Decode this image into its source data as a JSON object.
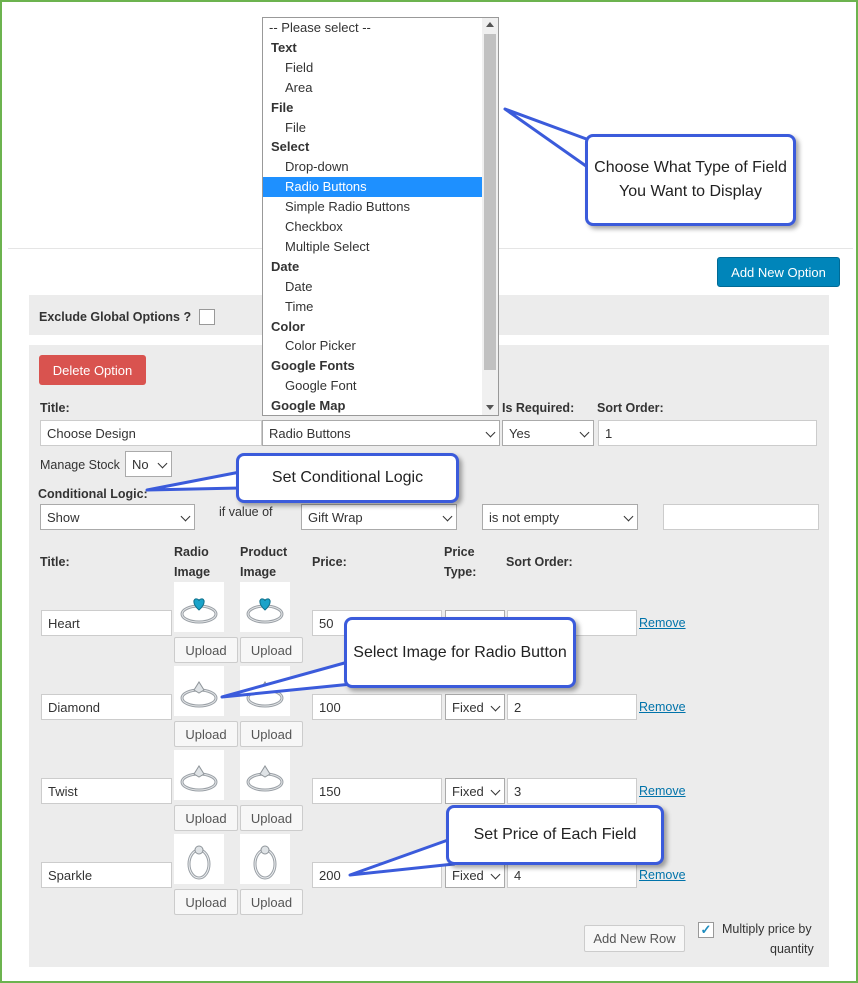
{
  "dropdown_list": {
    "items": [
      {
        "label": "-- Please select --",
        "kind": "placeholder"
      },
      {
        "label": "Text",
        "kind": "group"
      },
      {
        "label": "Field",
        "kind": "option"
      },
      {
        "label": "Area",
        "kind": "option"
      },
      {
        "label": "File",
        "kind": "group"
      },
      {
        "label": "File",
        "kind": "option"
      },
      {
        "label": "Select",
        "kind": "group"
      },
      {
        "label": "Drop-down",
        "kind": "option"
      },
      {
        "label": "Radio Buttons",
        "kind": "option",
        "selected": true
      },
      {
        "label": "Simple Radio Buttons",
        "kind": "option"
      },
      {
        "label": "Checkbox",
        "kind": "option"
      },
      {
        "label": "Multiple Select",
        "kind": "option"
      },
      {
        "label": "Date",
        "kind": "group"
      },
      {
        "label": "Date",
        "kind": "option"
      },
      {
        "label": "Time",
        "kind": "option"
      },
      {
        "label": "Color",
        "kind": "group"
      },
      {
        "label": "Color Picker",
        "kind": "option"
      },
      {
        "label": "Google Fonts",
        "kind": "group"
      },
      {
        "label": "Google Font",
        "kind": "option"
      },
      {
        "label": "Google Map",
        "kind": "group"
      }
    ]
  },
  "callouts": {
    "type": "Choose What Type of Field You Want to Display",
    "logic": "Set Conditional Logic",
    "image": "Select Image for Radio Button",
    "price": "Set Price of Each Field"
  },
  "add_new_option": "Add New Option",
  "exclude_global": "Exclude Global Options ?",
  "delete_option": "Delete Option",
  "option": {
    "title_label": "Title:",
    "title_value": "Choose Design",
    "type_value": "Radio Buttons",
    "required_label": "Is Required:",
    "required_value": "Yes",
    "sort_label": "Sort Order:",
    "sort_value": "1",
    "manage_stock_label": "Manage Stock",
    "manage_stock_value": "No",
    "conditional_label": "Conditional Logic:",
    "cond_action": "Show",
    "cond_if": "if value of",
    "cond_field": "Gift Wrap",
    "cond_operator": "is not empty",
    "cond_value": ""
  },
  "rows_header": {
    "title": "Title:",
    "radio_image_1": "Radio",
    "radio_image_2": "Image",
    "product_image_1": "Product",
    "product_image_2": "Image",
    "price": "Price:",
    "price_type_1": "Price",
    "price_type_2": "Type:",
    "sort_order": "Sort Order:"
  },
  "rows": [
    {
      "title": "Heart",
      "price": "50",
      "price_type": "Fixed",
      "sort": "1"
    },
    {
      "title": "Diamond",
      "price": "100",
      "price_type": "Fixed",
      "sort": "2"
    },
    {
      "title": "Twist",
      "price": "150",
      "price_type": "Fixed",
      "sort": "3"
    },
    {
      "title": "Sparkle",
      "price": "200",
      "price_type": "Fixed",
      "sort": "4"
    }
  ],
  "upload_label": "Upload",
  "remove_label": "Remove",
  "add_new_row": "Add New Row",
  "multiply_1": "Multiply price by",
  "multiply_2": "quantity",
  "colors": {
    "accent": "#0085ba",
    "danger": "#d9534f",
    "callout_border": "#3b5bdb",
    "frame": "#6cb34f",
    "selected": "#1e90ff"
  }
}
